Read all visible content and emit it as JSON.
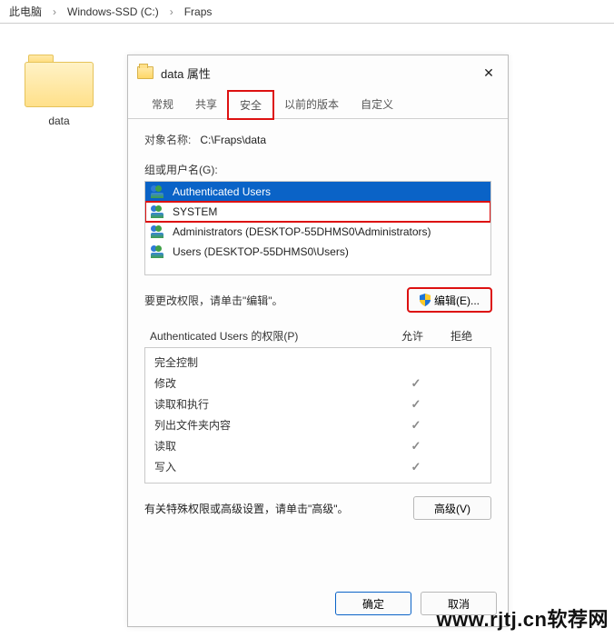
{
  "breadcrumb": {
    "sep": "›",
    "items": [
      "此电脑",
      "Windows-SSD (C:)",
      "Fraps"
    ]
  },
  "folder": {
    "label": "data"
  },
  "dialog": {
    "title": "data 属性",
    "close_glyph": "✕",
    "tabs": [
      {
        "label": "常规",
        "active": false
      },
      {
        "label": "共享",
        "active": false
      },
      {
        "label": "安全",
        "active": true,
        "highlighted": true
      },
      {
        "label": "以前的版本",
        "active": false
      },
      {
        "label": "自定义",
        "active": false
      }
    ],
    "object_label": "对象名称:",
    "object_path": "C:\\Fraps\\data",
    "groups_label": "组或用户名(G):",
    "groups": [
      {
        "name": "Authenticated Users",
        "selected": true
      },
      {
        "name": "SYSTEM",
        "selected": false,
        "highlighted": true
      },
      {
        "name": "Administrators (DESKTOP-55DHMS0\\Administrators)",
        "selected": false
      },
      {
        "name": "Users (DESKTOP-55DHMS0\\Users)",
        "selected": false
      }
    ],
    "edit_hint": "要更改权限，请单击\"编辑\"。",
    "edit_button": "编辑(E)...",
    "edit_highlighted": true,
    "perm_header_name": "Authenticated Users 的权限(P)",
    "perm_header_allow": "允许",
    "perm_header_deny": "拒绝",
    "permissions": [
      {
        "name": "完全控制",
        "allow": false,
        "deny": false
      },
      {
        "name": "修改",
        "allow": true,
        "deny": false
      },
      {
        "name": "读取和执行",
        "allow": true,
        "deny": false
      },
      {
        "name": "列出文件夹内容",
        "allow": true,
        "deny": false
      },
      {
        "name": "读取",
        "allow": true,
        "deny": false
      },
      {
        "name": "写入",
        "allow": true,
        "deny": false
      }
    ],
    "advanced_hint": "有关特殊权限或高级设置，请单击\"高级\"。",
    "advanced_button": "高级(V)",
    "ok_button": "确定",
    "cancel_button": "取消"
  },
  "watermark": "www.rjtj.cn软荐网",
  "glyphs": {
    "check": "✓"
  }
}
